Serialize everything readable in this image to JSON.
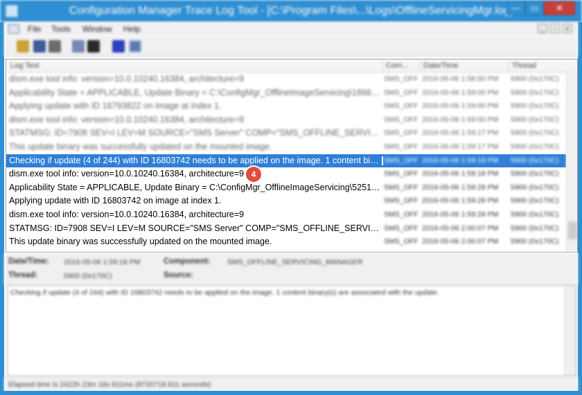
{
  "window": {
    "title": "Configuration Manager Trace Log Tool - [C:\\Program Files\\...\\Logs\\OfflineServicingMgr.log]",
    "min_glyph": "—",
    "max_glyph": "▭",
    "close_glyph": "✕"
  },
  "menu": {
    "items": [
      "File",
      "Tools",
      "Window",
      "Help"
    ],
    "mdi_buttons": [
      "_",
      "▫",
      "x"
    ]
  },
  "toolbar": {
    "icons": [
      "open-icon",
      "print-preview-icon",
      "print-icon",
      "copy-icon",
      "find-icon",
      "pause-icon",
      "highlight-icon"
    ]
  },
  "log": {
    "columns": [
      "Log Text",
      "Com...",
      "Date/Time",
      "Thread"
    ],
    "rows": [
      {
        "text": "dism.exe tool info: version=10.0.10240.16384, architecture=9",
        "component": "SMS_OFF",
        "datetime": "2016-05-06 1:58:50 PM",
        "thread": "5900 (0x170C)"
      },
      {
        "text": "Applicability State = APPLICABLE, Update Binary = C:\\ConfigMgr_OfflineImageServicing\\1866d...",
        "component": "SMS_OFF",
        "datetime": "2016-05-06 1:59:00 PM",
        "thread": "5900 (0x170C)"
      },
      {
        "text": "Applying update with ID 16793822 on image at index 1.",
        "component": "SMS_OFF",
        "datetime": "2016-05-06 1:59:00 PM",
        "thread": "5900 (0x170C)"
      },
      {
        "text": "dism.exe tool info: version=10.0.10240.16384, architecture=9",
        "component": "SMS_OFF",
        "datetime": "2016-05-06 1:59:00 PM",
        "thread": "5900 (0x170C)"
      },
      {
        "text": "STATMSG: ID=7908 SEV=I LEV=M SOURCE=\"SMS Server\" COMP=\"SMS_OFFLINE_SERVICING_M...",
        "component": "SMS_OFF",
        "datetime": "2016-05-06 1:59:17 PM",
        "thread": "5900 (0x170C)"
      },
      {
        "text": "This update binary was successfully updated on the mounted image.",
        "component": "SMS_OFF",
        "datetime": "2016-05-06 1:59:17 PM",
        "thread": "5900 (0x170C)"
      },
      {
        "text": "Checking if update (4 of 244) with ID 16803742 needs to be applied on the image. 1 content bin...",
        "component": "SMS_OFF",
        "datetime": "2016-05-06 1:59:18 PM",
        "thread": "5900 (0x170C)"
      },
      {
        "text": "dism.exe tool info: version=10.0.10240.16384, architecture=9",
        "component": "SMS_OFF",
        "datetime": "2016-05-06 1:59:18 PM",
        "thread": "5900 (0x170C)"
      },
      {
        "text": "Applicability State = APPLICABLE, Update Binary = C:\\ConfigMgr_OfflineImageServicing\\52514...",
        "component": "SMS_OFF",
        "datetime": "2016-05-06 1:59:28 PM",
        "thread": "5900 (0x170C)"
      },
      {
        "text": "Applying update with ID 16803742 on image at index 1.",
        "component": "SMS_OFF",
        "datetime": "2016-05-06 1:59:28 PM",
        "thread": "5900 (0x170C)"
      },
      {
        "text": "dism.exe tool info: version=10.0.10240.16384, architecture=9",
        "component": "SMS_OFF",
        "datetime": "2016-05-06 1:59:28 PM",
        "thread": "5900 (0x170C)"
      },
      {
        "text": "STATMSG: ID=7908 SEV=I LEV=M SOURCE=\"SMS Server\" COMP=\"SMS_OFFLINE_SERVICING_M...",
        "component": "SMS_OFF",
        "datetime": "2016-05-06 2:00:07 PM",
        "thread": "5900 (0x170C)"
      },
      {
        "text": "This update binary was successfully updated on the mounted image.",
        "component": "SMS_OFF",
        "datetime": "2016-05-06 2:00:07 PM",
        "thread": "5900 (0x170C)"
      }
    ],
    "selected_index": 6,
    "callout_badge": "4"
  },
  "details": {
    "datetime_label": "Date/Time:",
    "datetime_value": "2016-05-06 1:59:18 PM",
    "component_label": "Component:",
    "component_value": "SMS_OFFLINE_SERVICING_MANAGER",
    "thread_label": "Thread:",
    "thread_value": "5900 (0x170C)",
    "source_label": "Source:",
    "source_value": ""
  },
  "message": "Checking if update (4 of 244) with ID 16803742 needs to be applied on the image. 1 content binary(s) are associated with the update.",
  "status": "Elapsed time is 2422h 23m 18s 811ms (8720718.811 seconds)"
}
